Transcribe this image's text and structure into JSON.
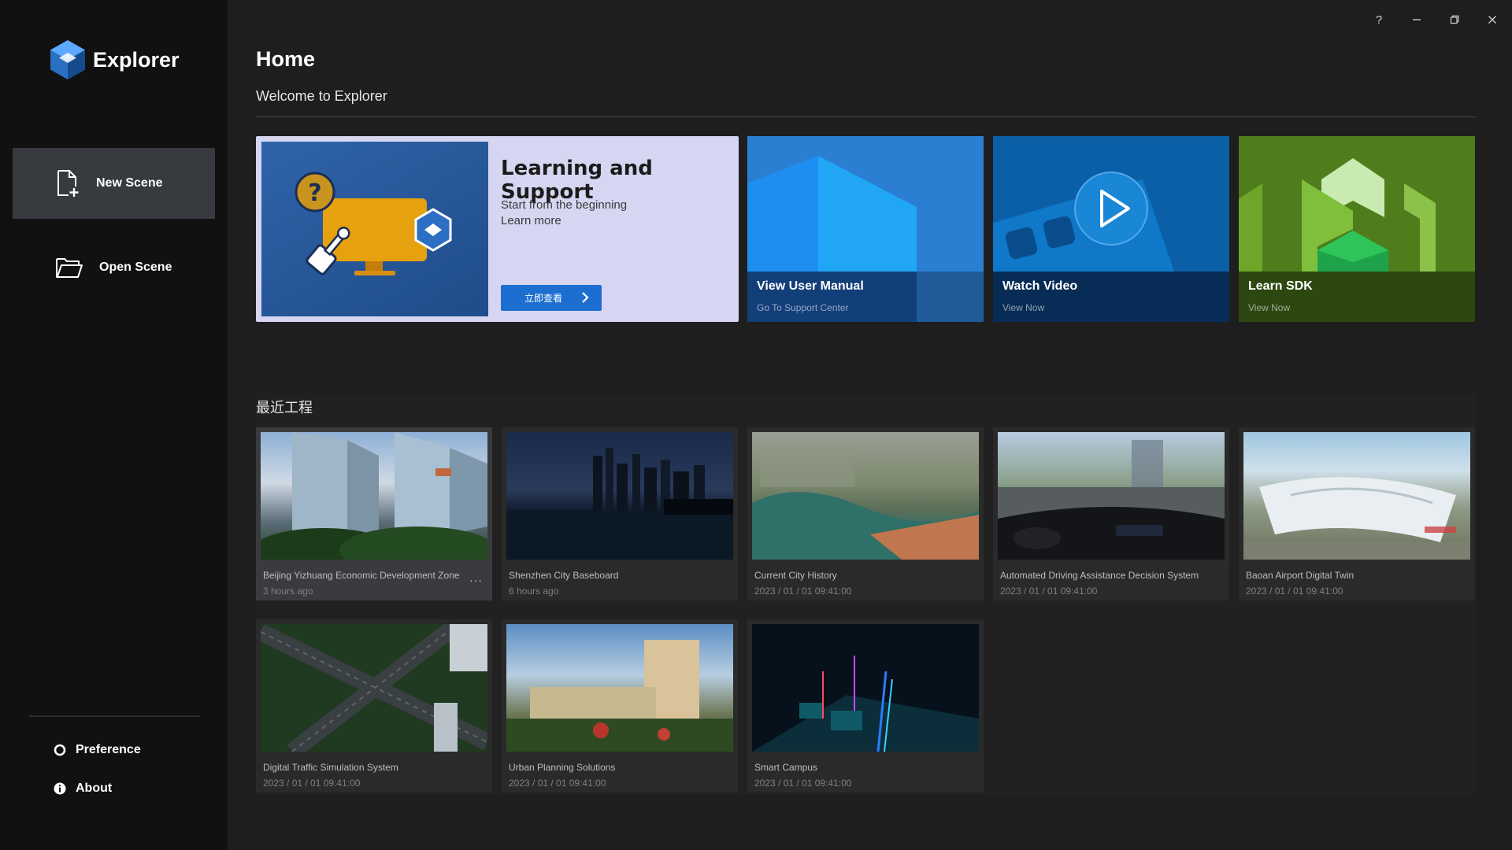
{
  "app": {
    "name": "Explorer"
  },
  "window": {
    "help_icon": "question-icon",
    "minimize_icon": "minimize-icon",
    "restore_icon": "restore-icon",
    "close_icon": "close-icon"
  },
  "sidebar": {
    "new_scene": {
      "label": "New Scene",
      "icon": "new-file-icon"
    },
    "open_scene": {
      "label": "Open Scene",
      "icon": "folder-icon"
    },
    "preference": {
      "label": "Preference",
      "icon": "settings-circle-icon"
    },
    "about": {
      "label": "About",
      "icon": "info-icon"
    }
  },
  "main": {
    "title": "Home",
    "subtitle": "Welcome to Explorer"
  },
  "learning": {
    "title": "Learning and Support",
    "line1": "Start from the beginning",
    "line2": "Learn more",
    "button_label": "立即查看"
  },
  "tiles": [
    {
      "title": "View User Manual",
      "subtitle": "Go To Support Center"
    },
    {
      "title": "Watch Video",
      "subtitle": "View Now"
    },
    {
      "title": "Learn SDK",
      "subtitle": "View Now"
    }
  ],
  "recent": {
    "title": "最近工程",
    "projects": [
      {
        "name": "Beijing Yizhuang Economic Development Zone",
        "time": "3 hours ago"
      },
      {
        "name": "Shenzhen City Baseboard",
        "time": "6 hours ago"
      },
      {
        "name": "Current City History",
        "time": "2023 / 01 / 01 09:41:00"
      },
      {
        "name": "Automated Driving Assistance Decision System",
        "time": "2023 / 01 / 01 09:41:00"
      },
      {
        "name": "Baoan Airport Digital Twin",
        "time": "2023 / 01 / 01 09:41:00"
      },
      {
        "name": "Digital Traffic Simulation System",
        "time": "2023 / 01 / 01 09:41:00"
      },
      {
        "name": "Urban Planning Solutions",
        "time": "2023 / 01 / 01 09:41:00"
      },
      {
        "name": "Smart Campus",
        "time": "2023 / 01 / 01 09:41:00"
      }
    ],
    "more_label": "···"
  },
  "colors": {
    "accent": "#1c6fd1",
    "sidebar": "#111111",
    "background": "#1e1e1e"
  }
}
